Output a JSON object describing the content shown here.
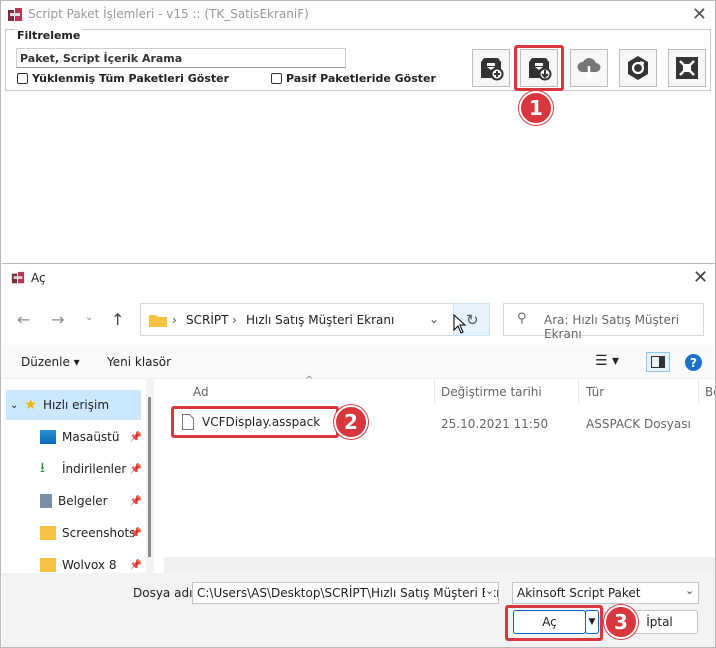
{
  "bg_window": {
    "title": "Script Paket İşlemleri - v15 :: (TK_SatisEkraniF)",
    "group_label": "Filtreleme",
    "search_placeholder": "Paket, Script İçerik Arama",
    "check_all": "Yüklenmiş Tüm Paketleri Göster",
    "check_passive": "Pasif Paketleride Göster",
    "toolbar": [
      "add-package-icon",
      "import-package-icon",
      "cloud-download-icon",
      "refresh-icon",
      "maximize-icon"
    ]
  },
  "badges": [
    "1",
    "2",
    "3"
  ],
  "dialog": {
    "title": "Aç",
    "address": [
      "SCRİPT",
      "Hızlı Satış Müşteri Ekranı"
    ],
    "search_placeholder": "Ara: Hızlı Satış Müşteri Ekranı",
    "organize": "Düzenle",
    "new_folder": "Yeni klasör",
    "nav_items": [
      {
        "label": "Hızlı erişim",
        "icon": "star-icon"
      },
      {
        "label": "Masaüstü",
        "icon": "desktop-icon"
      },
      {
        "label": "İndirilenler",
        "icon": "download-icon"
      },
      {
        "label": "Belgeler",
        "icon": "documents-icon"
      },
      {
        "label": "Screenshots",
        "icon": "folder-icon"
      },
      {
        "label": "Wolvox 8",
        "icon": "folder-icon"
      }
    ],
    "columns": [
      "Ad",
      "Değiştirme tarihi",
      "Tür",
      "Bo"
    ],
    "file": {
      "name": "VCFDisplay.asspack",
      "date": "25.10.2021 11:50",
      "type": "ASSPACK Dosyası"
    },
    "filename_label": "Dosya adı:",
    "filename_value": "C:\\Users\\AS\\Desktop\\SCRİPT\\Hızlı Satış Müşteri Ekran",
    "filter_value": "Akinsoft Script Paket",
    "open_button": "Aç",
    "cancel_button": "İptal"
  }
}
